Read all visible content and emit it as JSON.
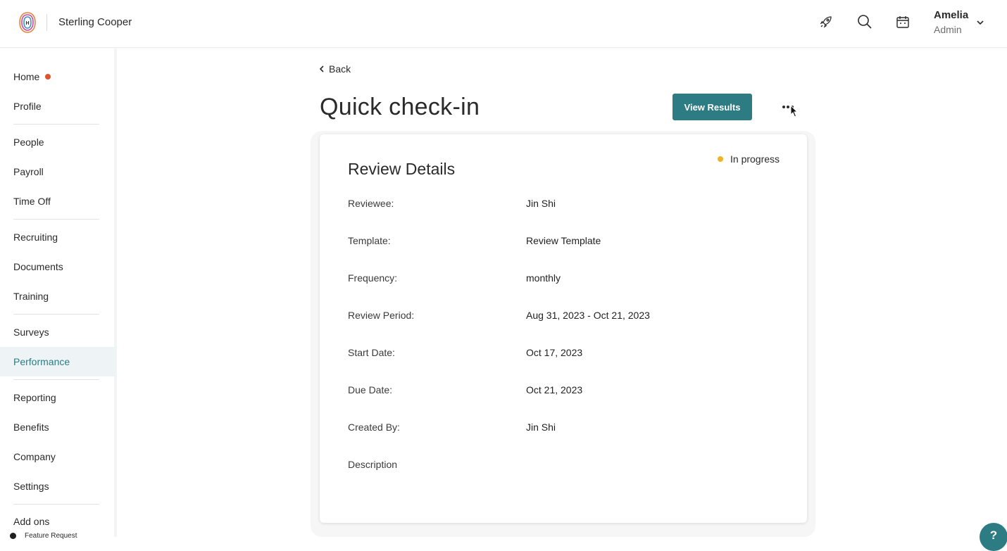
{
  "header": {
    "company": "Sterling Cooper",
    "user_name": "Amelia",
    "user_role": "Admin",
    "icons": [
      "rocket-icon",
      "search-icon",
      "calendar-icon",
      "chevron-down-icon"
    ]
  },
  "sidebar": {
    "items": [
      {
        "label": "Home"
      },
      {
        "label": "Profile"
      },
      {
        "label": "People"
      },
      {
        "label": "Payroll"
      },
      {
        "label": "Time Off"
      },
      {
        "label": "Recruiting"
      },
      {
        "label": "Documents"
      },
      {
        "label": "Training"
      },
      {
        "label": "Surveys"
      },
      {
        "label": "Performance"
      },
      {
        "label": "Reporting"
      },
      {
        "label": "Benefits"
      },
      {
        "label": "Company"
      },
      {
        "label": "Settings"
      },
      {
        "label": "Add ons"
      }
    ],
    "active": "Performance",
    "feature_request": "Feature Request"
  },
  "main": {
    "back_label": "Back",
    "title": "Quick check-in",
    "view_results_label": "View Results",
    "card": {
      "title": "Review Details",
      "status": "In progress",
      "rows": [
        {
          "label": "Reviewee:",
          "value": "Jin Shi"
        },
        {
          "label": "Template:",
          "value": "Review Template"
        },
        {
          "label": "Frequency:",
          "value": "monthly"
        },
        {
          "label": "Review Period:",
          "value": "Aug 31, 2023 - Oct 21, 2023"
        },
        {
          "label": "Start Date:",
          "value": "Oct 17, 2023"
        },
        {
          "label": "Due Date:",
          "value": "Oct 21, 2023"
        },
        {
          "label": "Created By:",
          "value": "Jin Shi"
        },
        {
          "label": "Description",
          "value": ""
        }
      ]
    }
  },
  "help_label": "?",
  "colors": {
    "accent": "#2d7b83",
    "status_in_progress": "#f0b323",
    "notification": "#e0532b"
  }
}
